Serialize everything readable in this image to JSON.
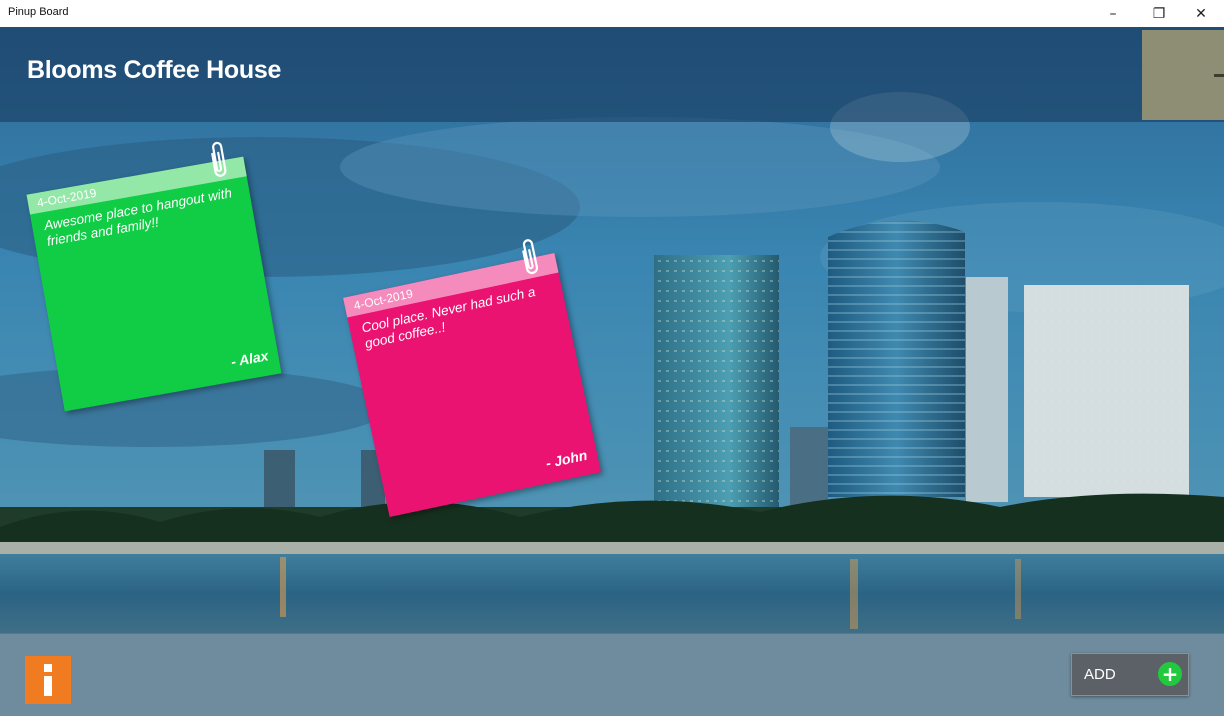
{
  "window": {
    "title": "Pinup Board",
    "minimize_glyph": "–",
    "restore_glyph": "❐",
    "close_glyph": "✕"
  },
  "header": {
    "title": "Blooms Coffee House",
    "thumbnail_color": "#8d8e74"
  },
  "notes": [
    {
      "date": "4-Oct-2019",
      "text": "Awesome place to hangout with friends and family!!",
      "author": "- Alax",
      "color": "#11cc45",
      "header_color": "#93e8a8",
      "icon": "paperclip-icon"
    },
    {
      "date": "4-Oct-2019",
      "text": "Cool place. Never had such a good coffee..!",
      "author": "- John",
      "color": "#ea1371",
      "header_color": "#f58bbc",
      "icon": "paperclip-icon"
    }
  ],
  "footer": {
    "info_icon": "info-icon",
    "info_color": "#f07b20",
    "add_label": "ADD",
    "add_icon": "plus-circle-icon",
    "add_icon_color": "#22c93d"
  }
}
